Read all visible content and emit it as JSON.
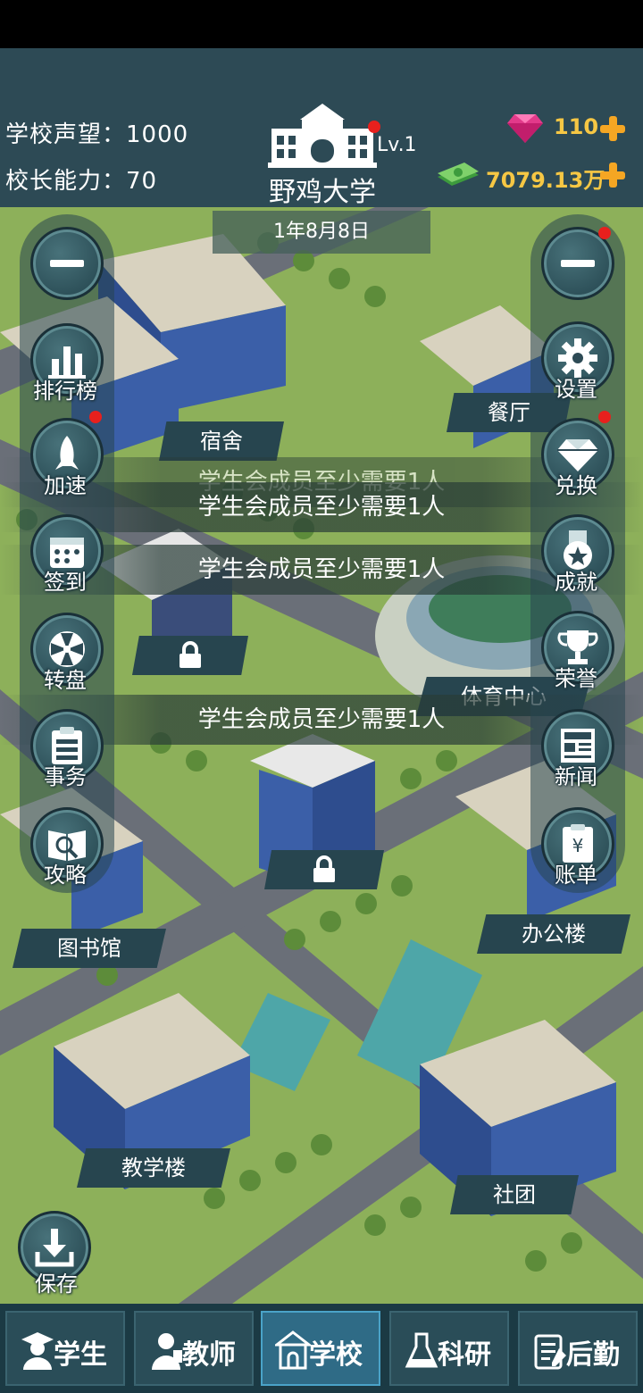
{
  "header": {
    "reputation_label": "学校声望：",
    "reputation_value": "1000",
    "ability_label": "校长能力：",
    "ability_value": "70",
    "school_name": "野鸡大学",
    "level": "Lv.1",
    "gems": "110",
    "money": "7079.13万",
    "date": "1年8月8日"
  },
  "left_menu": {
    "collapse_icon": "minus-icon",
    "items": [
      {
        "label": "排行榜",
        "icon": "bar-chart-icon"
      },
      {
        "label": "加速",
        "icon": "rocket-icon"
      },
      {
        "label": "签到",
        "icon": "calendar-icon"
      },
      {
        "label": "转盘",
        "icon": "wheel-icon"
      },
      {
        "label": "事务",
        "icon": "clipboard-icon"
      },
      {
        "label": "攻略",
        "icon": "guide-book-icon"
      }
    ]
  },
  "right_menu": {
    "collapse_icon": "minus-icon",
    "items": [
      {
        "label": "设置",
        "icon": "gear-icon"
      },
      {
        "label": "兑换",
        "icon": "diamond-icon"
      },
      {
        "label": "成就",
        "icon": "medal-icon"
      },
      {
        "label": "荣誉",
        "icon": "trophy-icon"
      },
      {
        "label": "新闻",
        "icon": "newspaper-icon"
      },
      {
        "label": "账单",
        "icon": "bill-icon"
      }
    ]
  },
  "buildings": {
    "dorm": "宿舍",
    "canteen": "餐厅",
    "sports": "体育中心",
    "library": "图书馆",
    "office": "办公楼",
    "teaching": "教学楼",
    "club": "社团"
  },
  "toasts": [
    "学生会成员至少需要1人",
    "学生会成员至少需要1人",
    "学生会成员至少需要1人",
    "学生会成员至少需要1人"
  ],
  "save_label": "保存",
  "tabs": [
    {
      "label": "学生",
      "icon": "student-icon"
    },
    {
      "label": "教师",
      "icon": "teacher-icon"
    },
    {
      "label": "学校",
      "icon": "school-icon"
    },
    {
      "label": "科研",
      "icon": "flask-icon"
    },
    {
      "label": "后勤",
      "icon": "logistics-icon"
    }
  ],
  "colors": {
    "header_bg": "#2d4a55",
    "gold": "#f6c744",
    "plus": "#f5a623",
    "badge": "#e8201d",
    "active_tab": "#2f6b86",
    "grass": "#8db05a"
  }
}
